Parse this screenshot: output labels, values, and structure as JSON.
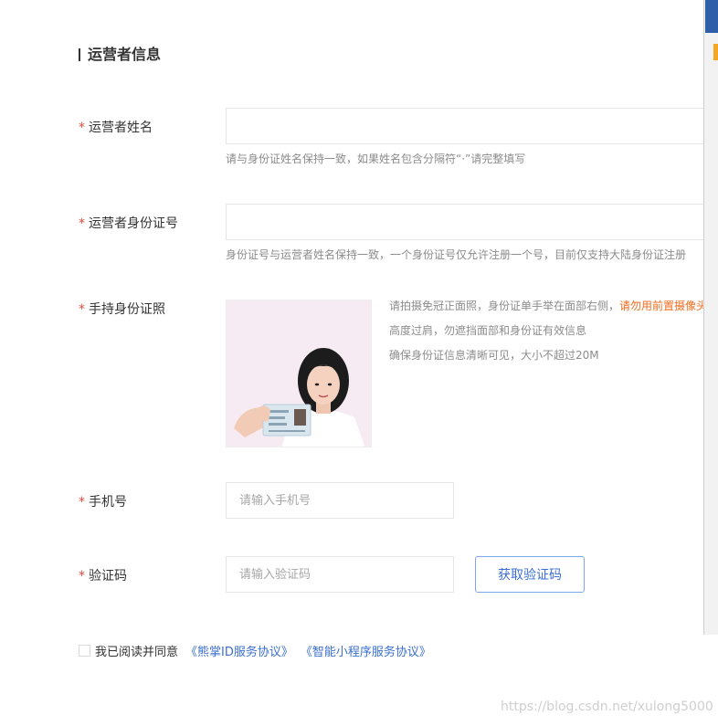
{
  "section": {
    "title": "运营者信息"
  },
  "fields": {
    "name": {
      "label": "运营者姓名",
      "value": "",
      "placeholder": "",
      "hint": "请与身份证姓名保持一致，如果姓名包含分隔符“·”请完整填写"
    },
    "idnum": {
      "label": "运营者身份证号",
      "value": "",
      "placeholder": "",
      "hint": "身份证号与运营者姓名保持一致，一个身份证号仅允许注册一个号，目前仅支持大陆身份证注册"
    },
    "photo": {
      "label": "手持身份证照",
      "tip1": "请拍摄免冠正面照，身份证单手举在面部右侧，",
      "tip1_warn": "请勿用前置摄像头",
      "tip2": "高度过肩，勿遮挡面部和身份证有效信息",
      "tip3": "确保身份证信息清晰可见，大小不超过20M"
    },
    "phone": {
      "label": "手机号",
      "placeholder": "请输入手机号"
    },
    "code": {
      "label": "验证码",
      "placeholder": "请输入验证码",
      "button": "获取验证码"
    }
  },
  "required_mark": "*",
  "agreement": {
    "checked": false,
    "text": "我已阅读并同意",
    "link1": "《熊掌ID服务协议》",
    "link2": "《智能小程序服务协议》"
  },
  "watermark": "https://blog.csdn.net/xulong5000",
  "colors": {
    "accent": "#3b6fd1",
    "required": "#e24a3b",
    "warning": "#f26a1b"
  }
}
